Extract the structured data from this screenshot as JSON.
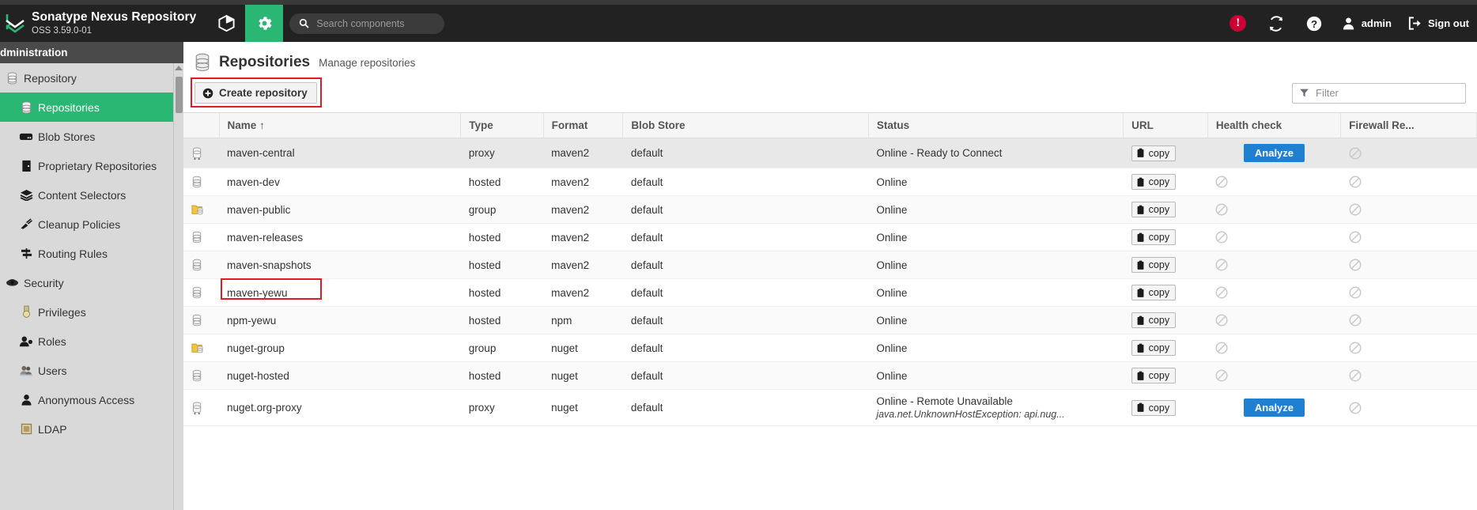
{
  "header": {
    "brand_title": "Sonatype Nexus Repository",
    "brand_subtitle": "OSS 3.59.0-01",
    "browse_icon": "cube-icon",
    "admin_gear_icon": "gear-icon",
    "search_placeholder": "Search components",
    "search_icon": "search-icon",
    "alert_icon": "alert-exclamation-icon",
    "alert_badge": "!",
    "refresh_icon": "refresh-icon",
    "help_icon": "help-question-icon",
    "user_icon": "user-icon",
    "user_label": "admin",
    "signout_icon": "sign-out-icon",
    "signout_label": "Sign out"
  },
  "sidebar": {
    "title": "dministration",
    "items": [
      {
        "label": "Repository",
        "icon": "database-icon",
        "level": 1,
        "selected": false
      },
      {
        "label": "Repositories",
        "icon": "database-icon",
        "level": 2,
        "selected": true
      },
      {
        "label": "Blob Stores",
        "icon": "blobstore-icon",
        "level": 2,
        "selected": false
      },
      {
        "label": "Proprietary Repositories",
        "icon": "proprietary-icon",
        "level": 2,
        "selected": false
      },
      {
        "label": "Content Selectors",
        "icon": "layers-icon",
        "level": 2,
        "selected": false
      },
      {
        "label": "Cleanup Policies",
        "icon": "broom-icon",
        "level": 2,
        "selected": false
      },
      {
        "label": "Routing Rules",
        "icon": "signpost-icon",
        "level": 2,
        "selected": false
      },
      {
        "label": "Security",
        "icon": "shield-icon",
        "level": 1,
        "selected": false
      },
      {
        "label": "Privileges",
        "icon": "privilege-icon",
        "level": 2,
        "selected": false
      },
      {
        "label": "Roles",
        "icon": "roles-icon",
        "level": 2,
        "selected": false
      },
      {
        "label": "Users",
        "icon": "users-icon",
        "level": 2,
        "selected": false
      },
      {
        "label": "Anonymous Access",
        "icon": "person-icon",
        "level": 2,
        "selected": false
      },
      {
        "label": "LDAP",
        "icon": "ldap-icon",
        "level": 2,
        "selected": false
      }
    ]
  },
  "page": {
    "icon": "database-icon",
    "title": "Repositories",
    "subtitle": "Manage repositories",
    "create_button": "Create repository",
    "create_button_icon": "plus-circle-icon",
    "filter_placeholder": "Filter",
    "filter_icon": "funnel-icon"
  },
  "table": {
    "columns": [
      "Name",
      "Type",
      "Format",
      "Blob Store",
      "Status",
      "URL",
      "Health check",
      "Firewall Re..."
    ],
    "sort_column": "Name",
    "sort_indicator": "↑",
    "copy_label": "copy",
    "copy_icon": "clipboard-icon",
    "analyze_label": "Analyze",
    "blocked_icon": "no-entry-icon",
    "rows": [
      {
        "icon": "proxy-icon",
        "name": "maven-central",
        "type": "proxy",
        "format": "maven2",
        "blob_store": "default",
        "status": "Online - Ready to Connect",
        "status_detail": "",
        "url": "copy",
        "health_check": "Analyze",
        "firewall": "blocked"
      },
      {
        "icon": "hosted-icon",
        "name": "maven-dev",
        "type": "hosted",
        "format": "maven2",
        "blob_store": "default",
        "status": "Online",
        "status_detail": "",
        "url": "copy",
        "health_check": "blocked",
        "firewall": "blocked"
      },
      {
        "icon": "group-icon",
        "name": "maven-public",
        "type": "group",
        "format": "maven2",
        "blob_store": "default",
        "status": "Online",
        "status_detail": "",
        "url": "copy",
        "health_check": "blocked",
        "firewall": "blocked"
      },
      {
        "icon": "hosted-icon",
        "name": "maven-releases",
        "type": "hosted",
        "format": "maven2",
        "blob_store": "default",
        "status": "Online",
        "status_detail": "",
        "url": "copy",
        "health_check": "blocked",
        "firewall": "blocked"
      },
      {
        "icon": "hosted-icon",
        "name": "maven-snapshots",
        "type": "hosted",
        "format": "maven2",
        "blob_store": "default",
        "status": "Online",
        "status_detail": "",
        "url": "copy",
        "health_check": "blocked",
        "firewall": "blocked"
      },
      {
        "icon": "hosted-icon",
        "name": "maven-yewu",
        "type": "hosted",
        "format": "maven2",
        "blob_store": "default",
        "status": "Online",
        "status_detail": "",
        "url": "copy",
        "health_check": "blocked",
        "firewall": "blocked",
        "highlighted": true
      },
      {
        "icon": "hosted-icon",
        "name": "npm-yewu",
        "type": "hosted",
        "format": "npm",
        "blob_store": "default",
        "status": "Online",
        "status_detail": "",
        "url": "copy",
        "health_check": "blocked",
        "firewall": "blocked"
      },
      {
        "icon": "group-icon",
        "name": "nuget-group",
        "type": "group",
        "format": "nuget",
        "blob_store": "default",
        "status": "Online",
        "status_detail": "",
        "url": "copy",
        "health_check": "blocked",
        "firewall": "blocked"
      },
      {
        "icon": "hosted-icon",
        "name": "nuget-hosted",
        "type": "hosted",
        "format": "nuget",
        "blob_store": "default",
        "status": "Online",
        "status_detail": "",
        "url": "copy",
        "health_check": "blocked",
        "firewall": "blocked"
      },
      {
        "icon": "proxy-icon",
        "name": "nuget.org-proxy",
        "type": "proxy",
        "format": "nuget",
        "blob_store": "default",
        "status": "Online - Remote Unavailable",
        "status_detail": "java.net.UnknownHostException: api.nug...",
        "url": "copy",
        "health_check": "Analyze",
        "firewall": "blocked"
      }
    ]
  },
  "colors": {
    "accent_green": "#2ab673",
    "header_dark": "#222222",
    "sidebar_bg": "#d9d9d9",
    "alert_red": "#cc0033",
    "highlight_red": "#e01b24",
    "analyze_blue": "#1f7fd0"
  }
}
